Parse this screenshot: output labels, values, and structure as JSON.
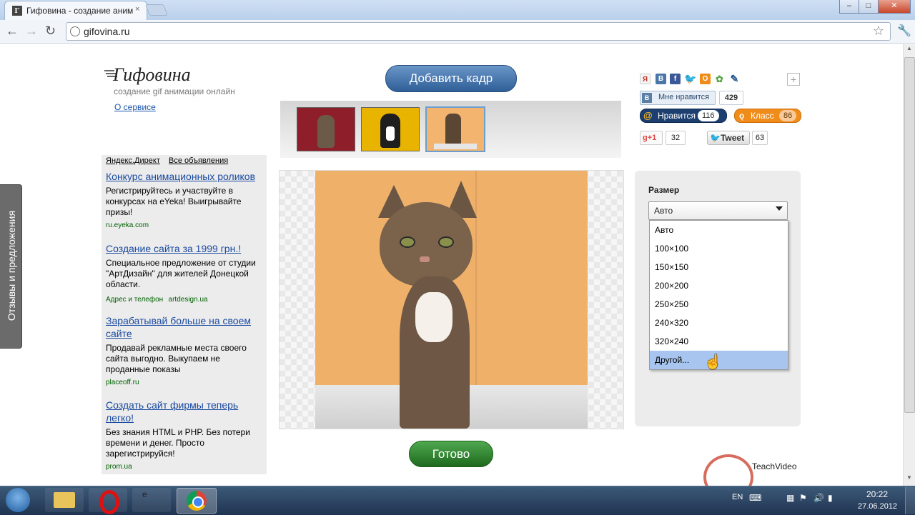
{
  "browser": {
    "tab_title": "Гифовина - создание аним",
    "tab_favicon": "Г",
    "tab_close": "×",
    "url": "gifovina.ru"
  },
  "site": {
    "logo": "Гифовина",
    "tagline": "создание gif анимации онлайн",
    "about_link": "О сервисе"
  },
  "ads": {
    "header_direct": "Яндекс.Директ",
    "header_all": "Все объявления",
    "items": [
      {
        "title": "Конкурс анимационных роликов",
        "text": "Регистрируйтесь и участвуйте в конкурсах на eYeka! Выигрывайте призы!",
        "url": "ru.eyeka.com",
        "extra": ""
      },
      {
        "title": "Создание сайта за 1999 грн.!",
        "text": "Специальное предложение от студии \"АртДизайн\" для жителей Донецкой области.",
        "url": "artdesign.ua",
        "extra": "Адрес и телефон"
      },
      {
        "title": "Зарабатывай больше на своем сайте",
        "text": "Продавай рекламные места своего сайта выгодно. Выкупаем не проданные показы",
        "url": "placeoff.ru",
        "extra": ""
      },
      {
        "title": "Создать сайт фирмы теперь легко!",
        "text": "Без знания HTML и PHP. Без потери времени и денег. Просто зарегистрируйся!",
        "url": "prom.ua",
        "extra": ""
      }
    ]
  },
  "feedback_tab": "Отзывы и предложения",
  "editor": {
    "add_frame_button": "Добавить кадр",
    "done_button": "Готово",
    "frames": [
      {
        "bg": "#8e1f2a",
        "name": "cat-1"
      },
      {
        "bg": "#e9b400",
        "name": "cat-2"
      },
      {
        "bg": "#f3b46f",
        "name": "cat-3"
      }
    ],
    "selected_frame_index": 2
  },
  "social": {
    "icons": [
      "odnoklassniki-icon",
      "vk-icon",
      "facebook-icon",
      "twitter-icon",
      "ok-icon",
      "moimir-icon",
      "livejournal-icon"
    ],
    "vk_like_label": "Мне нравится",
    "vk_like_count": "429",
    "mail_like_label": "Нравится",
    "mail_like_count": "116",
    "ok_class_label": "Класс",
    "ok_class_count": "86",
    "gplus_label": "+1",
    "gplus_count": "32",
    "tweet_label": "Tweet",
    "tweet_count": "63"
  },
  "size_panel": {
    "label": "Размер",
    "selected": "Авто",
    "options": [
      "Авто",
      "100×100",
      "150×150",
      "200×200",
      "250×250",
      "240×320",
      "320×240",
      "Другой..."
    ],
    "highlighted_index": 7
  },
  "watermark": "TeachVideo",
  "taskbar": {
    "lang": "EN",
    "time": "20:22",
    "date": "27.06.2012"
  },
  "colors": {
    "accent_blue": "#3a6aa5",
    "accent_green": "#2e8a2e",
    "ok_orange": "#f08c1a"
  }
}
